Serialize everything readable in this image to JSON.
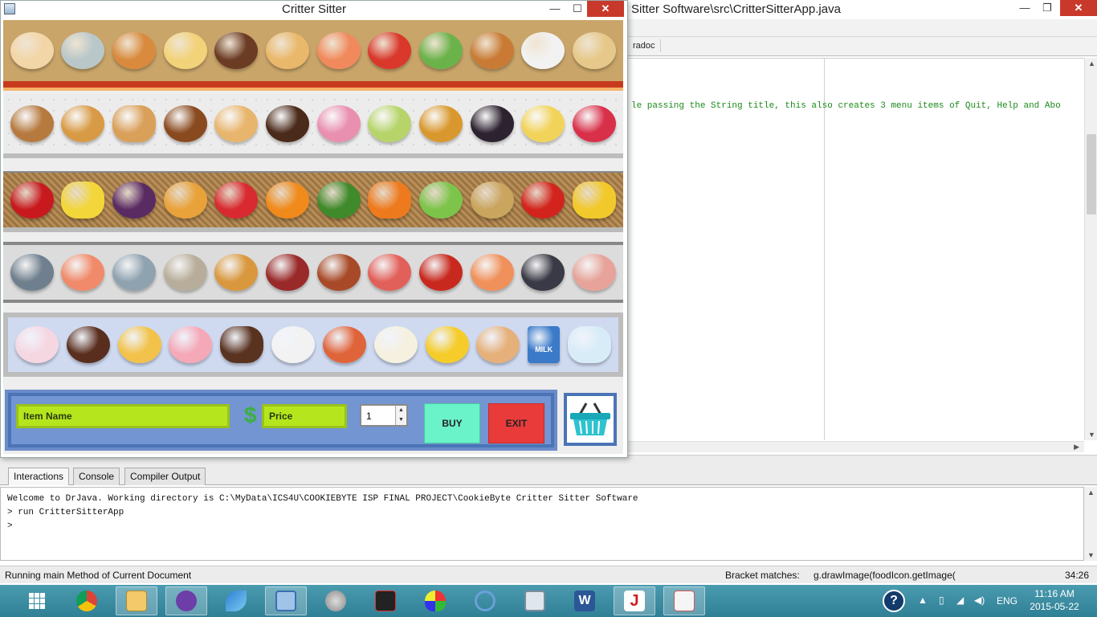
{
  "drjava": {
    "title": "Sitter Software\\src\\CritterSitterApp.java",
    "toolbar_button": "radoc",
    "code_line": "le passing the String title, this also creates 3 menu items of Quit, Help and Abo",
    "tabs": [
      {
        "label": "Interactions",
        "active": true
      },
      {
        "label": "Console",
        "active": false
      },
      {
        "label": "Compiler Output",
        "active": false
      }
    ],
    "console_lines": [
      "Welcome to DrJava.  Working directory is C:\\MyData\\ICS4U\\COOKIEBYTE ISP FINAL PROJECT\\CookieByte Critter Sitter Software",
      "> run CritterSitterApp",
      ">"
    ],
    "status": {
      "left": "Running main Method of Current Document",
      "bracket_label": "Bracket matches:",
      "bracket_value": "g.drawImage(foodIcon.getImage(",
      "position": "34:26"
    }
  },
  "critter_sitter": {
    "title": "Critter Sitter",
    "shelves": [
      [
        "breakfast-plate",
        "fish-dish",
        "lasagna",
        "spaghetti",
        "steak",
        "sandwich",
        "sushi",
        "tomato-soup",
        "salad",
        "burger",
        "rice-bowl",
        "noodle-soup"
      ],
      [
        "cookie",
        "croissant",
        "baguette",
        "pretzel",
        "toast",
        "chocolate-bar",
        "donuts",
        "macarons",
        "peanut-butter",
        "jam-jar",
        "chips",
        "candy"
      ],
      [
        "apple",
        "banana",
        "grapes",
        "mango",
        "strawberries",
        "orange",
        "broccoli",
        "carrot",
        "lettuce",
        "potato",
        "tomato",
        "corn"
      ],
      [
        "fish",
        "salmon-fillet",
        "trout",
        "oysters",
        "roast-chicken",
        "salami",
        "sausage",
        "octopus",
        "lobster",
        "shrimp",
        "mussels",
        "bacon"
      ],
      [
        "ice-cream-sundae",
        "chocolate-cake",
        "pudding",
        "strawberry-cake",
        "ice-pop",
        "yogurt",
        "pizza",
        "brie-cheese",
        "cheese-wedge",
        "eggs",
        "milk-carton",
        "water-bottle"
      ]
    ],
    "item_name_label": "Item Name",
    "currency_symbol": "$",
    "price_label": "Price",
    "quantity": "1",
    "buy_label": "BUY",
    "exit_label": "EXIT",
    "basket_icon": "shopping-basket",
    "milk_label": "MILK"
  },
  "taskbar": {
    "apps": [
      "start",
      "chrome",
      "file-explorer",
      "cat-app",
      "quill",
      "control-panel",
      "speaker",
      "ready-to-program",
      "paint",
      "snipping-tool",
      "calculator",
      "word",
      "java-j",
      "java"
    ],
    "language": "ENG",
    "time": "11:16 AM",
    "date": "2015-05-22"
  },
  "colors": {
    "buy": "#6af2c8",
    "exit": "#ea3b3b",
    "field": "#b5e61d",
    "control_bar": "#4a74b6",
    "taskbar": "#3a8ca2"
  }
}
